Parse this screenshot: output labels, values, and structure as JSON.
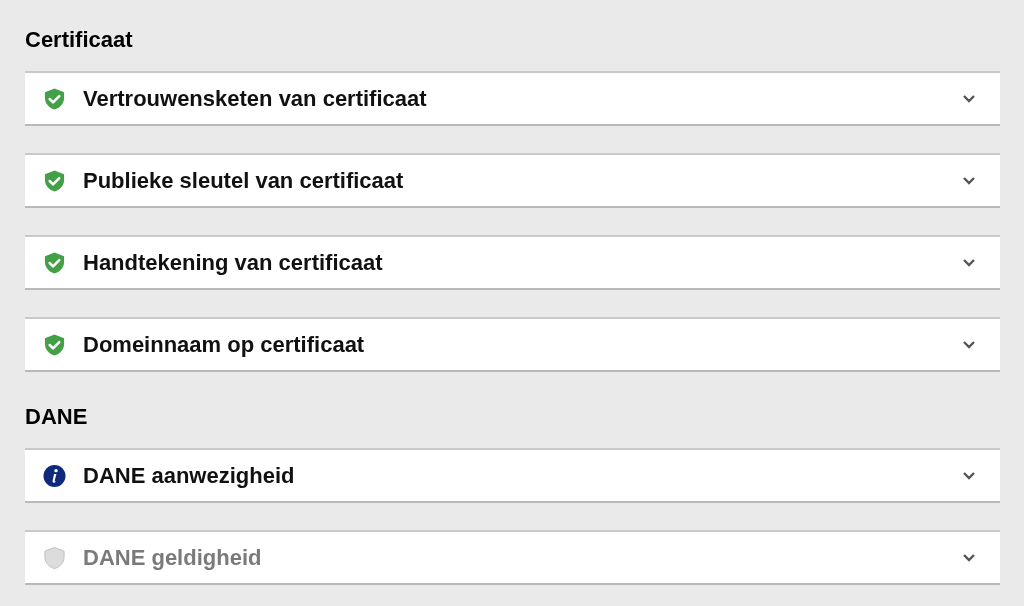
{
  "sections": [
    {
      "title": "Certificaat",
      "items": [
        {
          "label": "Vertrouwensketen van certificaat",
          "kind": "passed",
          "expanded": false
        },
        {
          "label": "Publieke sleutel van certificaat",
          "kind": "passed",
          "expanded": false
        },
        {
          "label": "Handtekening van certificaat",
          "kind": "passed",
          "expanded": false
        },
        {
          "label": "Domeinnaam op certificaat",
          "kind": "passed",
          "expanded": false
        }
      ]
    },
    {
      "title": "DANE",
      "items": [
        {
          "label": "DANE aanwezigheid",
          "kind": "info",
          "expanded": false
        },
        {
          "label": "DANE geldigheid",
          "kind": "untested",
          "expanded": false
        }
      ]
    }
  ]
}
